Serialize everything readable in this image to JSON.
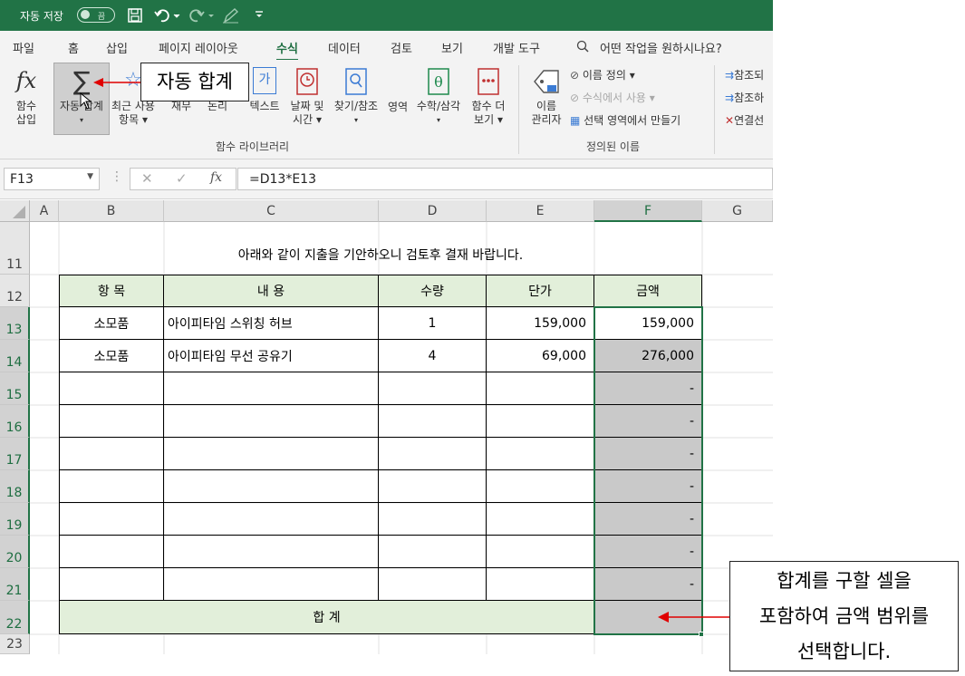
{
  "titlebar": {
    "autosave": "자동 저장",
    "toggle_state": "끔"
  },
  "tabs": [
    "파일",
    "홈",
    "삽입",
    "페이지 레이아웃",
    "수식",
    "데이터",
    "검토",
    "보기",
    "개발 도구"
  ],
  "active_tab": "수식",
  "tellme": "어떤 작업을 원하시나요?",
  "ribbon": {
    "insert_function": [
      "함수",
      "삽입"
    ],
    "autosum": [
      "자동 합계"
    ],
    "recent": [
      "최근 사용",
      "항목"
    ],
    "financial": [
      "재무"
    ],
    "logical": [
      "논리"
    ],
    "text": [
      "텍스트"
    ],
    "datetime": [
      "날짜 및",
      "시간"
    ],
    "lookup": [
      "찾기/참조",
      "영역"
    ],
    "math": [
      "수학/삼각"
    ],
    "more": [
      "함수 더",
      "보기"
    ],
    "library_label": "함수 라이브러리",
    "name_manager": [
      "이름",
      "관리자"
    ],
    "define_name": "이름 정의",
    "use_in_formula": "수식에서 사용",
    "create_from_selection": "선택 영역에서 만들기",
    "defined_names_label": "정의된 이름",
    "trace_precedents": "참조되",
    "trace_dependents": "참조하",
    "remove_arrows": "연결선"
  },
  "callouts": {
    "autosum": "자동 합계",
    "select_range": [
      "합계를 구할 셀을",
      "포함하여 금액 범위를",
      "선택합니다."
    ]
  },
  "namebox": "F13",
  "formula": "=D13*E13",
  "columns": [
    "A",
    "B",
    "C",
    "D",
    "E",
    "F",
    "G"
  ],
  "rows": [
    "11",
    "12",
    "13",
    "14",
    "15",
    "16",
    "17",
    "18",
    "19",
    "20",
    "21",
    "22",
    "23"
  ],
  "sheet": {
    "notice": "아래와 같이 지출을 기안하오니 검토후 결재 바랍니다.",
    "headers": [
      "항 목",
      "내 용",
      "수량",
      "단가",
      "금액"
    ],
    "items": [
      {
        "item": "소모품",
        "desc": "아이피타임 스위칭 허브",
        "qty": "1",
        "price": "159,000",
        "amount": "159,000"
      },
      {
        "item": "소모품",
        "desc": "아이피타임 무선 공유기",
        "qty": "4",
        "price": "69,000",
        "amount": "276,000"
      }
    ],
    "dash": "-",
    "total_label": "합 계"
  },
  "colors": {
    "excel_green": "#217346",
    "header_fill": "#e2efda",
    "selection_fill": "#c9c9c9",
    "arrow": "#e00000"
  }
}
